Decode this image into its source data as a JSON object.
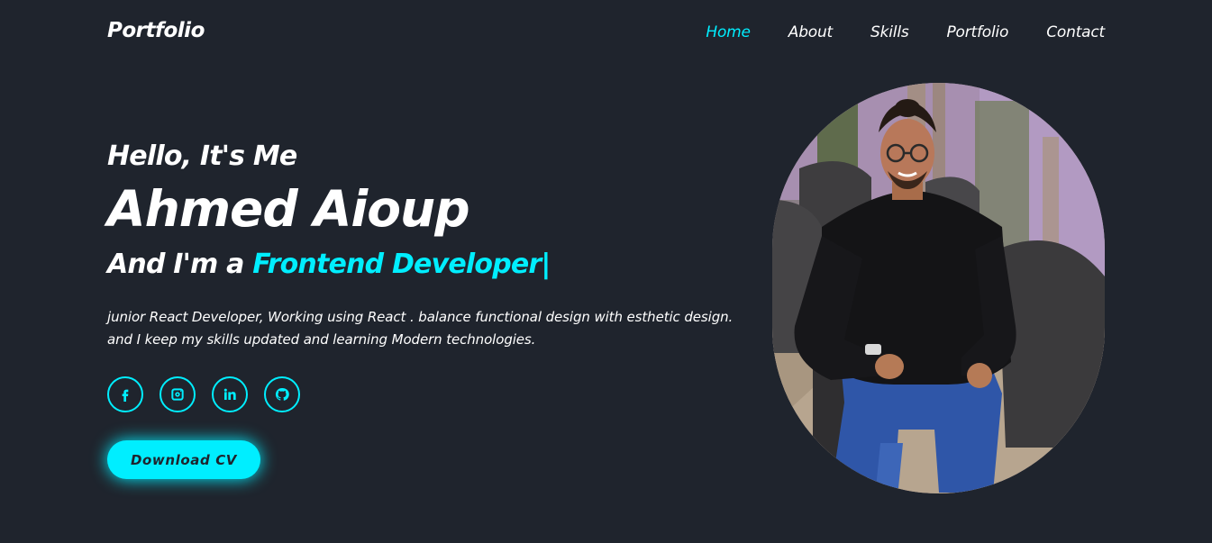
{
  "header": {
    "logo": "Portfolio",
    "nav": [
      "Home",
      "About",
      "Skills",
      "Portfolio",
      "Contact"
    ],
    "active": "Home"
  },
  "hero": {
    "greeting": "Hello, It's Me",
    "name": "Ahmed Aioup",
    "role_prefix": "And I'm a ",
    "role_highlight": "Frontend Developer|",
    "description": "junior React Developer, Working using React . balance functional design with esthetic design. and I keep my skills updated and learning Modern technologies.",
    "cta_label": "Download CV"
  },
  "socials": [
    {
      "icon": "facebook-icon"
    },
    {
      "icon": "instagram-icon"
    },
    {
      "icon": "linkedin-icon"
    },
    {
      "icon": "github-icon"
    }
  ],
  "colors": {
    "background": "#1f242d",
    "accent": "#00eeff",
    "text": "#ffffff"
  }
}
